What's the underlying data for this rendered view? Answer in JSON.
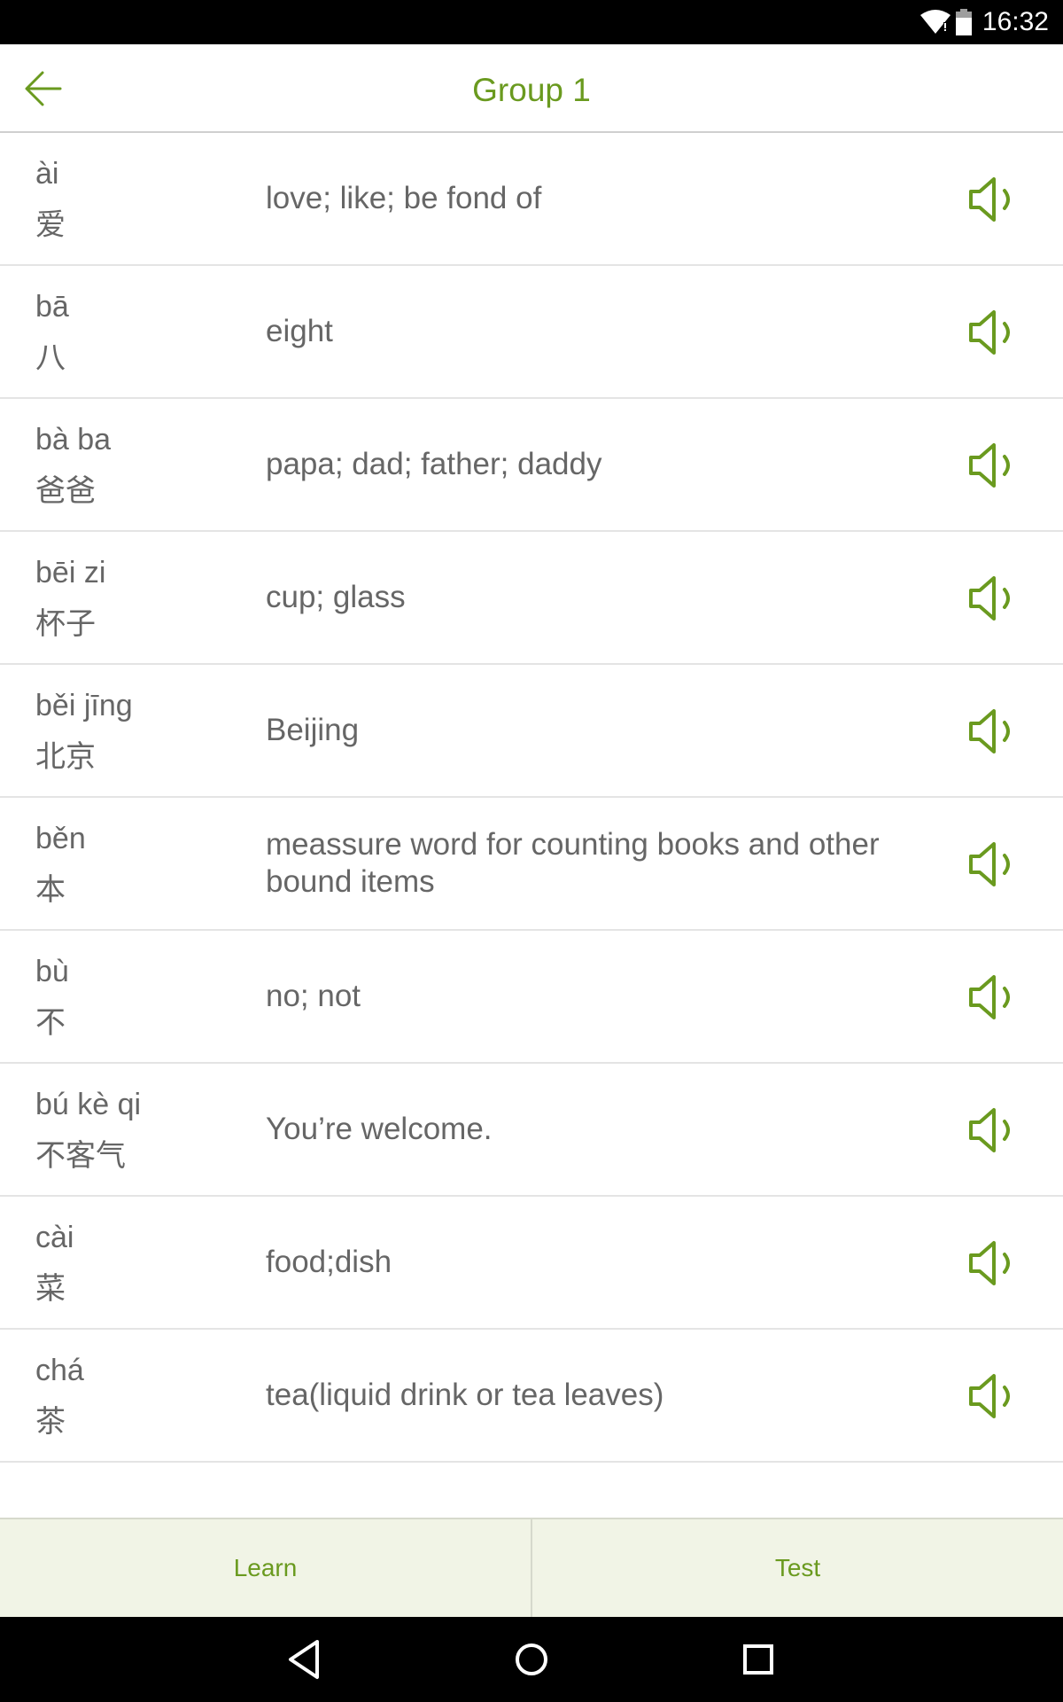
{
  "status_bar": {
    "time": "16:32",
    "icons": [
      "wifi-icon",
      "battery-icon"
    ]
  },
  "header": {
    "title": "Group 1",
    "back_icon": "arrow-left-icon"
  },
  "colors": {
    "accent": "#6a9a1f",
    "text": "#666666",
    "bottom_bar_bg": "#f1f4e6"
  },
  "words": [
    {
      "pinyin": "ài",
      "hanzi": "爱",
      "meaning": "love; like; be fond of"
    },
    {
      "pinyin": "bā",
      "hanzi": "八",
      "meaning": "eight"
    },
    {
      "pinyin": "bà ba",
      "hanzi": "爸爸",
      "meaning": "papa; dad; father; daddy"
    },
    {
      "pinyin": "bēi zi",
      "hanzi": "杯子",
      "meaning": "cup; glass"
    },
    {
      "pinyin": "běi jīng",
      "hanzi": "北京",
      "meaning": "Beijing"
    },
    {
      "pinyin": "běn",
      "hanzi": "本",
      "meaning": "meassure word for counting books and other bound items"
    },
    {
      "pinyin": "bù",
      "hanzi": "不",
      "meaning": "no; not"
    },
    {
      "pinyin": "bú kè qi",
      "hanzi": "不客气",
      "meaning": "You’re welcome."
    },
    {
      "pinyin": "cài",
      "hanzi": "菜",
      "meaning": "food;dish"
    },
    {
      "pinyin": "chá",
      "hanzi": "茶",
      "meaning": "tea(liquid drink or tea leaves)"
    }
  ],
  "bottom_bar": {
    "learn_label": "Learn",
    "test_label": "Test"
  }
}
